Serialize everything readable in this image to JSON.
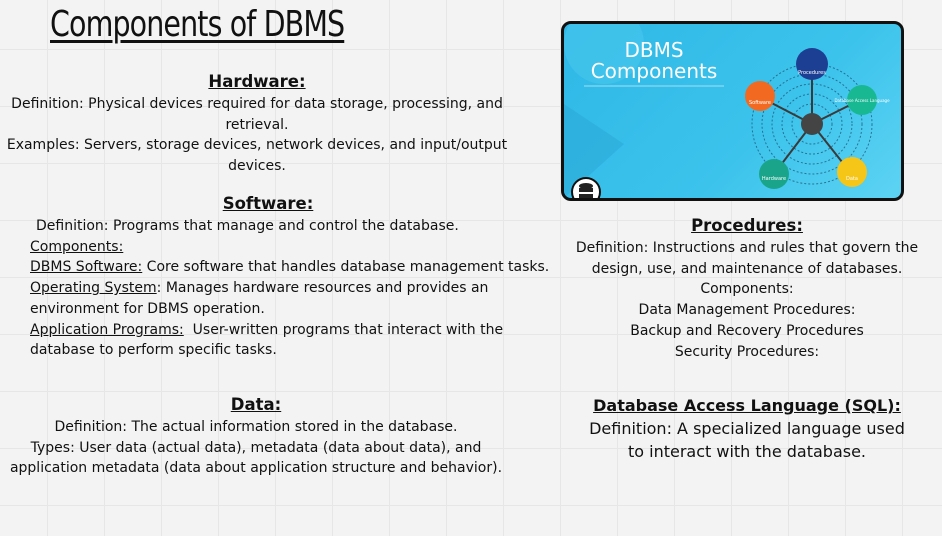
{
  "title": "Components of DBMS",
  "hardware": {
    "heading": "Hardware:",
    "lines": [
      "Definition: Physical devices required for data storage, processing, and",
      "retrieval.",
      "Examples: Servers, storage devices, network devices, and input/output",
      "devices."
    ]
  },
  "software": {
    "heading": "Software:",
    "definition": "Definition: Programs that manage and control the database.",
    "components_label": "Components:",
    "items": [
      {
        "label": "DBMS Software:",
        "text": " Core software that handles database management tasks."
      },
      {
        "label": "Operating System",
        "text": ": Manages hardware resources and provides an",
        "cont": "environment for DBMS operation."
      },
      {
        "label": "Application Programs:",
        "text": "  User-written programs that interact with the",
        "cont": "database to perform specific tasks."
      }
    ]
  },
  "data": {
    "heading": "Data:",
    "lines": [
      "Definition: The actual information stored in the database.",
      "Types: User data (actual data), metadata (data about data), and",
      "application metadata (data about application structure and behavior)."
    ]
  },
  "procedures": {
    "heading": "Procedures:",
    "lines": [
      "Definition: Instructions and rules that govern the",
      "design, use, and maintenance of databases.",
      "Components:",
      "Data Management Procedures:",
      "Backup and Recovery Procedures",
      "Security Procedures:"
    ]
  },
  "sql": {
    "heading": "Database Access Language (SQL):",
    "lines": [
      "Definition: A specialized language used",
      "to interact with the database."
    ]
  },
  "image": {
    "title1": "DBMS",
    "title2": "Components",
    "nodes": {
      "procedures": "Procedures",
      "dal": "Database Access Language",
      "software": "Software",
      "hardware": "Hardware",
      "data": "Data"
    }
  }
}
